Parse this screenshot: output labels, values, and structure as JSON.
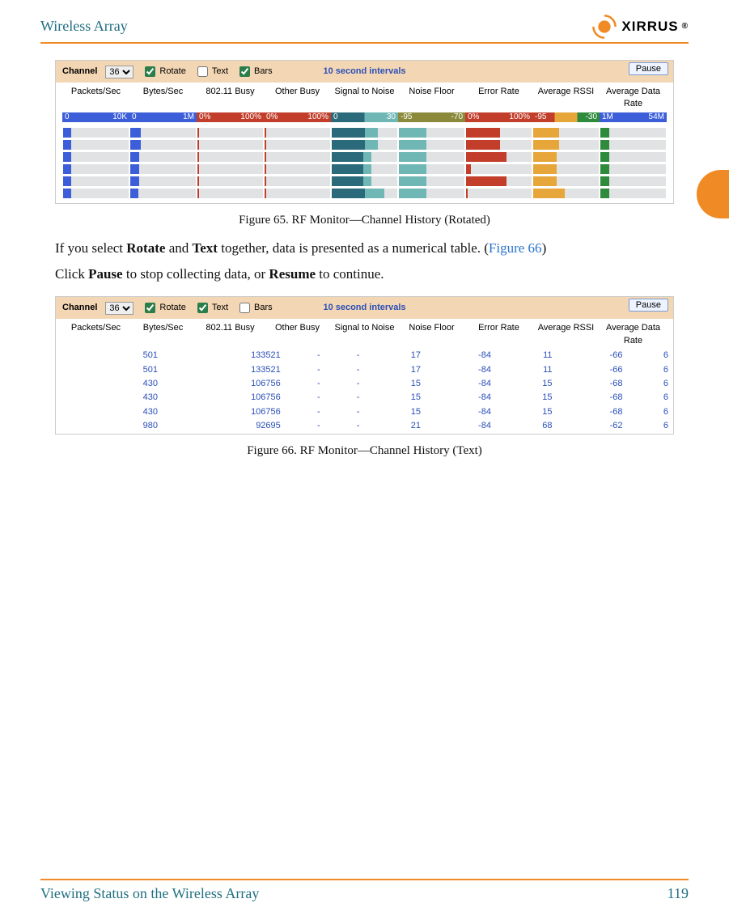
{
  "header": {
    "title": "Wireless Array",
    "brand": "XIRRUS"
  },
  "footer": {
    "section": "Viewing Status on the Wireless Array",
    "page": "119"
  },
  "figA": {
    "caption": "Figure 65. RF Monitor—Channel History (Rotated)",
    "channel_label": "Channel",
    "channel_value": "36",
    "rotate_label": "Rotate",
    "rotate_checked": true,
    "text_label": "Text",
    "text_checked": false,
    "bars_label": "Bars",
    "bars_checked": true,
    "interval": "10 second intervals",
    "pause": "Pause",
    "columns": [
      "Packets/Sec",
      "Bytes/Sec",
      "802.11 Busy",
      "Other Busy",
      "Signal to Noise",
      "Noise Floor",
      "Error Rate",
      "Average RSSI",
      "Average Data Rate"
    ],
    "scales": [
      {
        "cls": "blue",
        "lo": "0",
        "hi": "10K"
      },
      {
        "cls": "blue",
        "lo": "0",
        "hi": "1M"
      },
      {
        "cls": "red",
        "lo": "0%",
        "hi": "100%"
      },
      {
        "cls": "red",
        "lo": "0%",
        "hi": "100%"
      },
      {
        "cls": "teal",
        "lo": "0",
        "hi": "30"
      },
      {
        "cls": "olive",
        "lo": "-95",
        "hi": "-70"
      },
      {
        "cls": "red",
        "lo": "0%",
        "hi": "100%"
      },
      {
        "cls": "rag",
        "lo": "-95",
        "hi": "-30"
      },
      {
        "cls": "wide",
        "lo": "1M",
        "hi": "54M"
      }
    ],
    "rows": [
      [
        {
          "c": "c-blue",
          "w": 12
        },
        {
          "c": "c-blue",
          "w": 16
        },
        {
          "c": "c-red",
          "w": 3
        },
        {
          "c": "c-red",
          "w": 3
        },
        {
          "c": "c-tdk",
          "w": 50,
          "ext": {
            "c": "c-tlt",
            "w": 20
          }
        },
        {
          "c": "c-tlt",
          "w": 42
        },
        {
          "c": "c-red",
          "w": 52
        },
        {
          "c": "c-amb",
          "w": 40
        },
        {
          "c": "c-grn",
          "w": 14
        }
      ],
      [
        {
          "c": "c-blue",
          "w": 12
        },
        {
          "c": "c-blue",
          "w": 16
        },
        {
          "c": "c-red",
          "w": 3
        },
        {
          "c": "c-red",
          "w": 3
        },
        {
          "c": "c-tdk",
          "w": 50,
          "ext": {
            "c": "c-tlt",
            "w": 20
          }
        },
        {
          "c": "c-tlt",
          "w": 42
        },
        {
          "c": "c-red",
          "w": 52
        },
        {
          "c": "c-amb",
          "w": 40
        },
        {
          "c": "c-grn",
          "w": 14
        }
      ],
      [
        {
          "c": "c-blue",
          "w": 12
        },
        {
          "c": "c-blue",
          "w": 14
        },
        {
          "c": "c-red",
          "w": 3
        },
        {
          "c": "c-red",
          "w": 3
        },
        {
          "c": "c-tdk",
          "w": 48,
          "ext": {
            "c": "c-tlt",
            "w": 12
          }
        },
        {
          "c": "c-tlt",
          "w": 42
        },
        {
          "c": "c-red",
          "w": 62
        },
        {
          "c": "c-amb",
          "w": 36
        },
        {
          "c": "c-grn",
          "w": 14
        }
      ],
      [
        {
          "c": "c-blue",
          "w": 12
        },
        {
          "c": "c-blue",
          "w": 14
        },
        {
          "c": "c-red",
          "w": 3
        },
        {
          "c": "c-red",
          "w": 3
        },
        {
          "c": "c-tdk",
          "w": 48,
          "ext": {
            "c": "c-tlt",
            "w": 12
          }
        },
        {
          "c": "c-tlt",
          "w": 42
        },
        {
          "c": "c-red",
          "w": 8
        },
        {
          "c": "c-amb",
          "w": 36
        },
        {
          "c": "c-grn",
          "w": 14
        }
      ],
      [
        {
          "c": "c-blue",
          "w": 12
        },
        {
          "c": "c-blue",
          "w": 14
        },
        {
          "c": "c-red",
          "w": 3
        },
        {
          "c": "c-red",
          "w": 3
        },
        {
          "c": "c-tdk",
          "w": 48,
          "ext": {
            "c": "c-tlt",
            "w": 12
          }
        },
        {
          "c": "c-tlt",
          "w": 42
        },
        {
          "c": "c-red",
          "w": 62
        },
        {
          "c": "c-amb",
          "w": 36
        },
        {
          "c": "c-grn",
          "w": 14
        }
      ],
      [
        {
          "c": "c-blue",
          "w": 12
        },
        {
          "c": "c-blue",
          "w": 12
        },
        {
          "c": "c-red",
          "w": 3
        },
        {
          "c": "c-red",
          "w": 3
        },
        {
          "c": "c-tdk",
          "w": 50,
          "ext": {
            "c": "c-tlt",
            "w": 30
          }
        },
        {
          "c": "c-tlt",
          "w": 42
        },
        {
          "c": "c-red",
          "w": 3
        },
        {
          "c": "c-amb",
          "w": 48
        },
        {
          "c": "c-grn",
          "w": 14
        }
      ]
    ]
  },
  "body": {
    "p1_pre": "If you select ",
    "p1_b1": "Rotate",
    "p1_mid1": " and ",
    "p1_b2": "Text",
    "p1_post": " together, data is presented as a numerical table. (",
    "p1_link": "Figure 66",
    "p1_close": ")",
    "p2_pre": "Click ",
    "p2_b1": "Pause",
    "p2_mid": " to stop collecting data, or ",
    "p2_b2": "Resume",
    "p2_post": " to continue."
  },
  "figB": {
    "caption": "Figure 66. RF Monitor—Channel History (Text)",
    "channel_label": "Channel",
    "channel_value": "36",
    "rotate_label": "Rotate",
    "rotate_checked": true,
    "text_label": "Text",
    "text_checked": true,
    "bars_label": "Bars",
    "bars_checked": false,
    "interval": "10 second intervals",
    "pause": "Pause",
    "columns": [
      "Packets/Sec",
      "Bytes/Sec",
      "802.11 Busy",
      "Other Busy",
      "Signal to Noise",
      "Noise Floor",
      "Error Rate",
      "Average RSSI",
      "Average Data Rate"
    ],
    "rows": [
      [
        "501",
        "133521",
        "-",
        "-",
        "17",
        "-84",
        "11",
        "-66",
        "6"
      ],
      [
        "501",
        "133521",
        "-",
        "-",
        "17",
        "-84",
        "11",
        "-66",
        "6"
      ],
      [
        "430",
        "106756",
        "-",
        "-",
        "15",
        "-84",
        "15",
        "-68",
        "6"
      ],
      [
        "430",
        "106756",
        "-",
        "-",
        "15",
        "-84",
        "15",
        "-68",
        "6"
      ],
      [
        "430",
        "106756",
        "-",
        "-",
        "15",
        "-84",
        "15",
        "-68",
        "6"
      ],
      [
        "980",
        "92695",
        "-",
        "-",
        "21",
        "-84",
        "68",
        "-62",
        "6"
      ]
    ]
  }
}
